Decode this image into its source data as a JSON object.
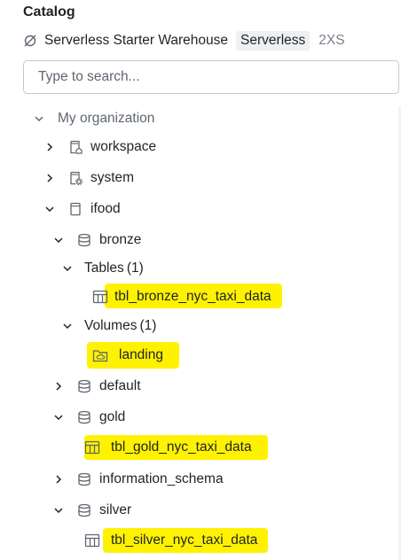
{
  "panel": {
    "title": "Catalog"
  },
  "warehouse": {
    "name": "Serverless Starter Warehouse",
    "type": "Serverless",
    "size": "2XS",
    "icon": "no-connection-icon"
  },
  "search": {
    "placeholder": "Type to search..."
  },
  "tree": {
    "root": {
      "label": "My organization"
    },
    "catalogs": [
      {
        "label": "workspace",
        "icon": "catalog-home-icon"
      },
      {
        "label": "system",
        "icon": "catalog-gear-icon"
      },
      {
        "label": "ifood",
        "icon": "catalog-icon"
      }
    ],
    "schemas": {
      "bronze": "bronze",
      "default": "default",
      "gold": "gold",
      "information_schema": "information_schema",
      "silver": "silver"
    },
    "bronze_groups": {
      "tables_label": "Tables",
      "tables_count": "(1)",
      "volumes_label": "Volumes",
      "volumes_count": "(1)"
    },
    "items": {
      "bronze_table": "tbl_bronze_nyc_taxi_data",
      "landing_volume": "landing",
      "gold_table": "tbl_gold_nyc_taxi_data",
      "silver_table": "tbl_silver_nyc_taxi_data"
    }
  },
  "colors": {
    "highlight": "#fff200",
    "muted": "#5f6670",
    "icon": "#5f6670"
  }
}
